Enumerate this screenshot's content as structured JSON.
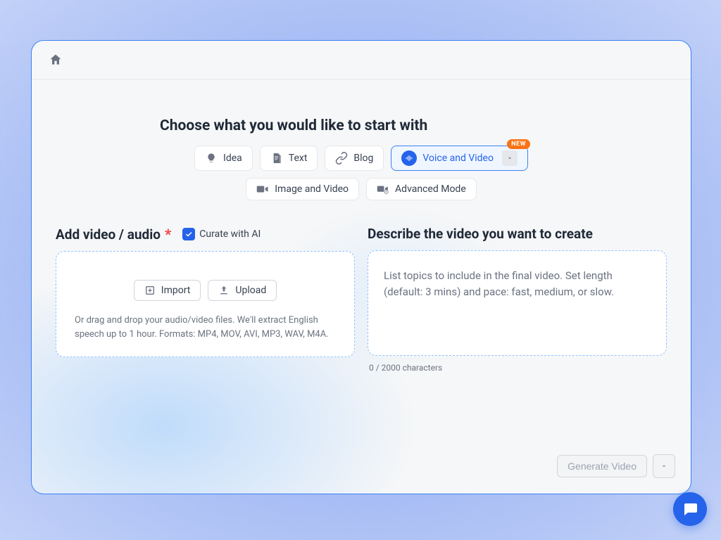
{
  "heading": "Choose what you would like to start with",
  "tabs": {
    "idea": "Idea",
    "text": "Text",
    "blog": "Blog",
    "voice_video": "Voice and Video",
    "image_video": "Image and Video",
    "advanced": "Advanced Mode",
    "new_badge": "NEW"
  },
  "left": {
    "title": "Add video / audio",
    "curate_label": "Curate with AI",
    "curate_checked": true,
    "import_label": "Import",
    "upload_label": "Upload",
    "hint": "Or drag and drop your audio/video files. We'll extract English speech up to 1 hour. Formats: MP4, MOV, AVI, MP3, WAV, M4A."
  },
  "right": {
    "title": "Describe the video you want to create",
    "placeholder": "List topics to include in the final video. Set length (default: 3 mins) and pace: fast, medium, or slow.",
    "char_count": "0 / 2000 characters"
  },
  "footer": {
    "generate": "Generate Video"
  }
}
